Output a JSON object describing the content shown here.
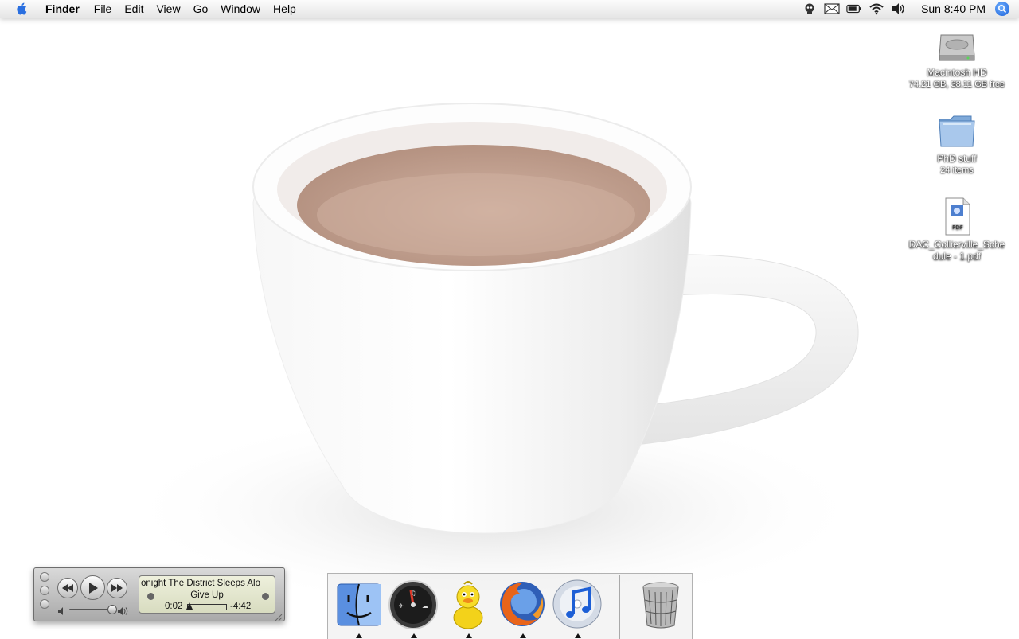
{
  "menubar": {
    "apple_icon": "apple-icon",
    "app_name": "Finder",
    "menus": [
      "File",
      "Edit",
      "View",
      "Go",
      "Window",
      "Help"
    ],
    "clock": "Sun 8:40 PM",
    "status_icons": [
      "ichat-status-icon",
      "mail-icon",
      "battery-icon",
      "wifi-icon",
      "volume-icon"
    ],
    "spotlight_icon": "spotlight-icon"
  },
  "desktop": {
    "icons": [
      {
        "label": "Macintosh HD",
        "sub": "74.21 GB, 38.11 GB free",
        "icon": "hard-drive-icon"
      },
      {
        "label": "PhD stuff",
        "sub": "24 items",
        "icon": "folder-icon"
      },
      {
        "label": "DAC_Collierville_Sche dule - 1.pdf",
        "sub": "",
        "icon": "pdf-file-icon",
        "badge": "PDF"
      }
    ]
  },
  "mini_player": {
    "line1": "onight   The District Sleeps Alo",
    "line2": "Give Up",
    "elapsed": "0:02",
    "remaining": "-4:42",
    "progress_fraction": 0.01,
    "volume_fraction": 0.9
  },
  "dock": {
    "apps": [
      {
        "name": "Finder",
        "icon": "finder-icon",
        "running": true
      },
      {
        "name": "Dashboard",
        "icon": "dashboard-icon",
        "running": true
      },
      {
        "name": "Adium",
        "icon": "adium-duck-icon",
        "running": true
      },
      {
        "name": "Firefox",
        "icon": "firefox-icon",
        "running": true
      },
      {
        "name": "iTunes",
        "icon": "itunes-icon",
        "running": true
      }
    ],
    "trash": {
      "name": "Trash",
      "icon": "trash-icon"
    }
  },
  "colors": {
    "wallpaper_bg": "#ffffff",
    "cup": "#f4f4f4",
    "coffee": "#c4a696",
    "lcd": "#e6e8d0"
  }
}
